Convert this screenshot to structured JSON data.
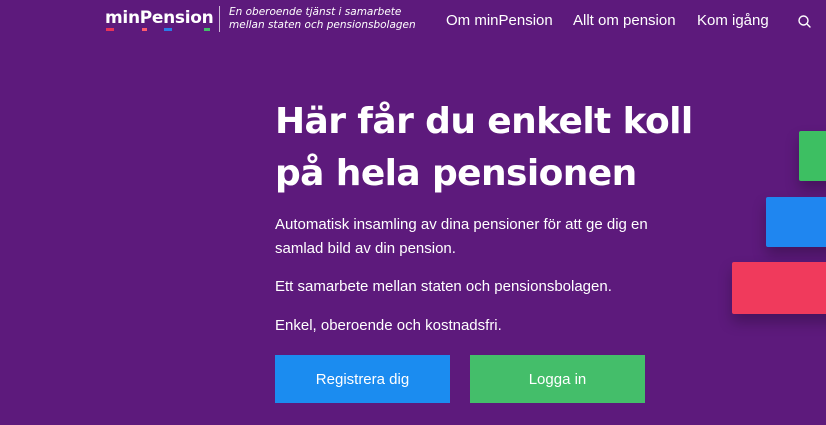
{
  "header": {
    "logo_text": "minPension",
    "logo_bar_colors": [
      "#e8335a",
      "#ff5a6e",
      "#2a7ce8",
      "#44be6a"
    ],
    "tagline_line1": "En oberoende tjänst i samarbete",
    "tagline_line2": "mellan staten och pensionsbolagen",
    "nav": [
      "Om minPension",
      "Allt om pension",
      "Kom igång"
    ],
    "search_icon": "search-icon"
  },
  "hero": {
    "title": "Här får du enkelt koll på hela pensionen",
    "paragraph1": "Automatisk insamling av dina pensioner för att ge dig en samlad bild av din pension.",
    "paragraph2": "Ett samarbete mellan staten och pensionsbolagen.",
    "paragraph3": "Enkel, oberoende och kostnadsfri.",
    "register_label": "Registrera dig",
    "login_label": "Logga in"
  },
  "colors": {
    "background": "#5d1a7c",
    "register_button": "#1b8cf0",
    "login_button": "#44be6a",
    "block_green": "#3dbf62",
    "block_blue": "#1f86f0",
    "block_red": "#f03a5c"
  }
}
